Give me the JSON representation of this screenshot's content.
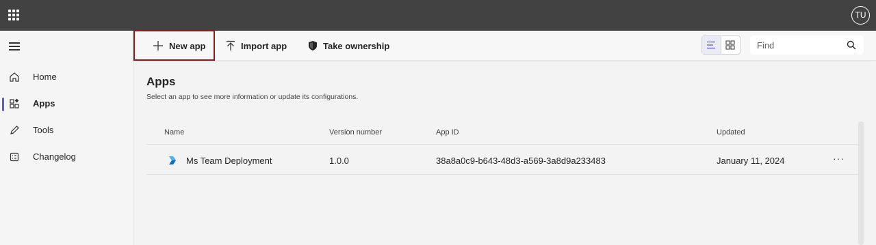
{
  "header": {
    "app_launcher_icon": "waffle-icon",
    "avatar_initials": "TU"
  },
  "sidebar": {
    "menu_icon": "hamburger-icon",
    "items": [
      {
        "label": "Home",
        "icon": "home-icon",
        "active": false
      },
      {
        "label": "Apps",
        "icon": "apps-icon",
        "active": true
      },
      {
        "label": "Tools",
        "icon": "pencil-icon",
        "active": false
      },
      {
        "label": "Changelog",
        "icon": "changelog-icon",
        "active": false
      }
    ]
  },
  "toolbar": {
    "new_app_label": "New app",
    "import_app_label": "Import app",
    "take_ownership_label": "Take ownership",
    "find_placeholder": "Find",
    "highlight_color": "#8b1a1a"
  },
  "main": {
    "title": "Apps",
    "subtitle": "Select an app to see more information or update its configurations.",
    "table": {
      "columns": [
        "Name",
        "Version number",
        "App ID",
        "Updated"
      ],
      "rows": [
        {
          "name": "Ms Team Deployment",
          "version": "1.0.0",
          "app_id": "38a8a0c9-b643-48d3-a569-3a8d9a233483",
          "updated": "January 11, 2024",
          "more": "···"
        }
      ]
    }
  },
  "colors": {
    "topbar": "#424242",
    "accent": "#5b5fc7"
  }
}
